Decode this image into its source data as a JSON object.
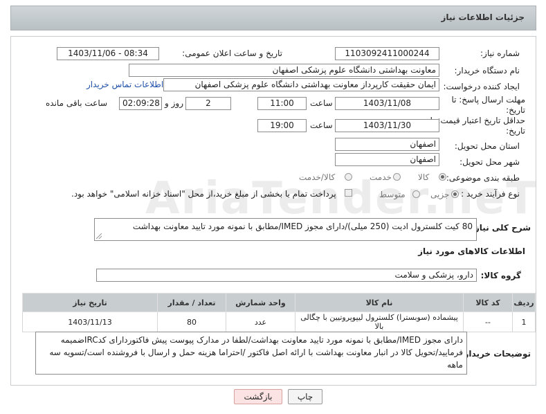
{
  "header": {
    "title": "جزئیات اطلاعات نیاز"
  },
  "form": {
    "need_number_label": "شماره نیاز:",
    "need_number": "1103092411000244",
    "announce_label": "تاریخ و ساعت اعلان عمومی:",
    "announce_value": "1403/11/06 - 08:34",
    "buyer_org_label": "نام دستگاه خریدار:",
    "buyer_org": "معاونت بهداشتی دانشگاه علوم پزشکی اصفهان",
    "requester_label": "ایجاد کننده درخواست:",
    "requester": "ایمان حقیقت کارپرداز معاونت بهداشتی دانشگاه علوم پزشکی اصفهان",
    "contact_link": "اطلاعات تماس خریدار",
    "deadline_label": "مهلت ارسال پاسخ: تا تاریخ:",
    "deadline_date": "1403/11/08",
    "time_label": "ساعت",
    "deadline_time": "11:00",
    "days_value": "2",
    "days_label": "روز و",
    "remaining_time": "02:09:28",
    "remaining_label": "ساعت باقی مانده",
    "validity_label": "حداقل تاریخ اعتبار قیمت: تا تاریخ:",
    "validity_date": "1403/11/30",
    "validity_time": "19:00",
    "province_label": "استان محل تحویل:",
    "province": "اصفهان",
    "city_label": "شهر محل تحویل:",
    "city": "اصفهان",
    "category_label": "طبقه بندی موضوعی:",
    "category_options": [
      "کالا",
      "خدمت",
      "کالا/خدمت"
    ],
    "process_label": "نوع فرآیند خرید :",
    "process_options": [
      "جزیی",
      "متوسط"
    ],
    "payment_text": "پرداخت تمام یا بخشی از مبلغ خرید،از محل \"اسناد خزانه اسلامی\" خواهد بود."
  },
  "summary": {
    "label": "شرح کلی نیاز:",
    "text": "80 کیت کلسترول ادیت (250 میلی)/دارای مجوز IMED/مطابق با نمونه مورد تایید معاونت بهداشت"
  },
  "goods": {
    "section_title": "اطلاعات کالاهای مورد نیاز",
    "group_label": "گروه کالا:",
    "group_value": "دارو، پزشکی و سلامت",
    "columns": [
      "ردیف",
      "کد کالا",
      "نام کالا",
      "واحد شمارش",
      "تعداد / مقدار",
      "تاریخ نیاز"
    ],
    "rows": [
      [
        "1",
        "--",
        "پیشماده (سوبسترا) کلسترول لیپوپروتیین با چگالی بالا",
        "عدد",
        "80",
        "1403/11/13"
      ]
    ]
  },
  "buyer_notes": {
    "label": "توضیحات خریدار:",
    "text": "دارای مجوز IMED/مطابق با نمونه مورد تایید معاونت بهداشت/لطفا در مدارک پیوست پیش فاکتوردارای کدIRCضمیمه فرمایید/تحویل کالا در انبار معاونت بهداشت با ارائه اصل فاکتور /احتراما هزینه حمل و ارسال با فروشنده است/تسویه سه ماهه"
  },
  "buttons": {
    "print": "چاپ",
    "back": "بازگشت"
  },
  "watermark": "AriaTender.neT"
}
